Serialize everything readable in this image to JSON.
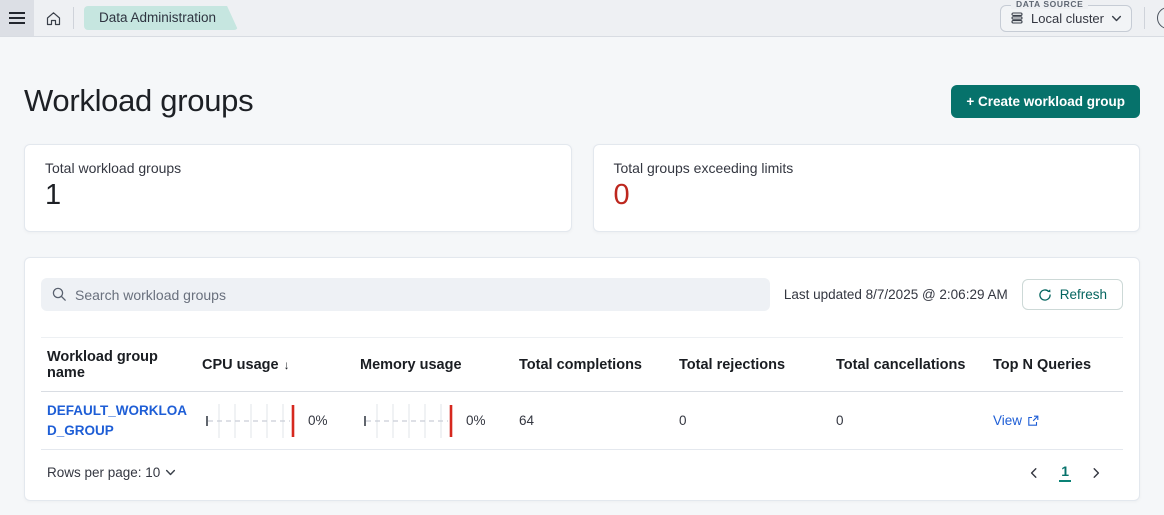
{
  "topbar": {
    "breadcrumb": "Data Administration",
    "data_source": {
      "label": "DATA SOURCE",
      "value": "Local cluster"
    }
  },
  "page": {
    "title": "Workload groups",
    "create_button": "+ Create workload group"
  },
  "stats": {
    "cards": [
      {
        "label": "Total workload groups",
        "value": "1"
      },
      {
        "label": "Total groups exceeding limits",
        "value": "0"
      }
    ]
  },
  "toolbar": {
    "search_placeholder": "Search workload groups",
    "last_updated": "Last updated 8/7/2025 @ 2:06:29 AM",
    "refresh_label": "Refresh"
  },
  "table": {
    "columns": [
      "Workload group name",
      "CPU usage",
      "Memory usage",
      "Total completions",
      "Total rejections",
      "Total cancellations",
      "Top N Queries"
    ],
    "sort_indicator": "↓",
    "rows": [
      {
        "name": "DEFAULT_WORKLOAD_GROUP",
        "cpu_usage": "0%",
        "memory_usage": "0%",
        "total_completions": "64",
        "total_rejections": "0",
        "total_cancellations": "0",
        "top_n_label": "View"
      }
    ]
  },
  "footer": {
    "rows_per_page": "Rows per page: 10",
    "page_number": "1"
  },
  "colors": {
    "primary_teal": "#06726b",
    "danger_red": "#bd271e",
    "link_blue": "#1e5ed6",
    "gauge_limit_red": "#d6281e",
    "breadcrumb_tag_bg": "#c6e6e0"
  },
  "icons": {
    "menu": "hamburger",
    "home": "house-outline",
    "database": "stacked-disks",
    "chevron_down": "v",
    "help": "circle (clipped at edge)",
    "search": "magnifier",
    "refresh": "circular-arrow",
    "sort_desc": "↓",
    "external_link": "box-with-arrow",
    "chevron_left": "‹",
    "chevron_right": "›"
  }
}
